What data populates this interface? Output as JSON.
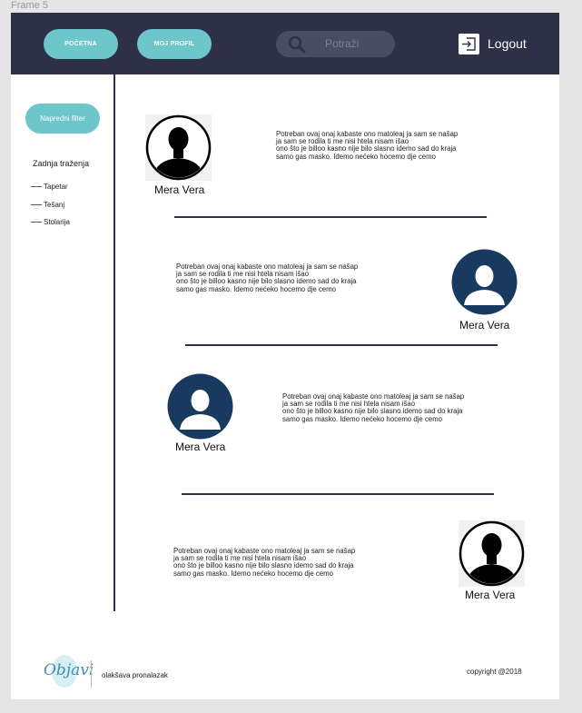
{
  "frame_label": "Frame 5",
  "header": {
    "home_label": "POČETNA",
    "profile_label": "MOJ PROFIL",
    "search_placeholder": "Potraži",
    "logout_label": "Logout"
  },
  "sidebar": {
    "filter_label": "Napredni filter",
    "recent_title": "Zadnja traženja",
    "recent_items": [
      "Tapetar",
      "Tešanj",
      "Stolarija"
    ]
  },
  "posts": [
    {
      "name": "Mera Vera",
      "lines": [
        "Potreban ovaj onaj kabaste ono matoleaj ja sam se našap",
        "ja sam se rodila ti me nisi htela nisam išao",
        "ono što je billoo kasno nije bilo slasno idemo sad do kraja",
        "samo gas masko. Idemo nećeko hocemo dje cemo"
      ]
    },
    {
      "name": "Mera Vera",
      "lines": [
        "Potreban ovaj onaj kabaste ono matoleaj ja sam se našap",
        "ja sam se rodila ti me nisi htela nisam išao",
        "ono što je billoo kasno nije bilo slasno idemo sad do kraja",
        "samo gas masko. Idemo nećeko hocemo dje cemo"
      ]
    },
    {
      "name": "Mera Vera",
      "lines": [
        "Potreban ovaj onaj kabaste ono matoleaj ja sam se našap",
        "ja sam se rodila ti me nisi htela nisam išao",
        "ono što je billoo kasno nije bilo slasno idemo sad do kraja",
        "samo gas masko. Idemo nećeko hocemo dje cemo"
      ]
    },
    {
      "name": "Mera Vera",
      "lines": [
        "Potreban ovaj onaj kabaste ono matoleaj ja sam se našap",
        "ja sam se rodila ti me nisi htela nisam išao",
        "ono što je billoo kasno nije bilo slasno idemo sad do kraja",
        "samo gas masko. Idemo nećeko hocemo dje cemo"
      ]
    }
  ],
  "footer": {
    "logo_text": "Objavi",
    "tagline": "olakšava pronalazak",
    "copyright": "copyright @2018"
  },
  "colors": {
    "header_bg": "#2d3047",
    "accent": "#6dc6c9",
    "avatar_dark": "#173a5e",
    "logo": "#3e8fb5"
  }
}
